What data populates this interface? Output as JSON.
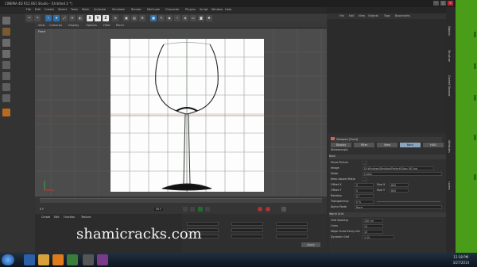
{
  "window": {
    "title": "CINEMA 4D R12.061 Studio - [Untitled 2 *]"
  },
  "menubar": [
    "File",
    "Edit",
    "Create",
    "Select",
    "Tools",
    "Mesh",
    "Animate",
    "Simulate",
    "Render",
    "MoGraph",
    "Character",
    "Plugins",
    "Script",
    "Window",
    "Help"
  ],
  "layout": {
    "label": "Layout:",
    "value": "Startup"
  },
  "toolbar": {
    "x": "X",
    "y": "Y",
    "z": "Z"
  },
  "viewport": {
    "menu": [
      "View",
      "Cameras",
      "Display",
      "Options",
      "Filter",
      "Panel"
    ],
    "label": "Front"
  },
  "timeline": {
    "start": "0 F",
    "end": "90 F",
    "current": "0 F"
  },
  "material_manager": {
    "menu": [
      "Create",
      "Edit",
      "Function",
      "Texture"
    ]
  },
  "coords": {
    "apply": "Apply"
  },
  "object_manager": {
    "menu": [
      "File",
      "Edit",
      "View",
      "Objects",
      "Tags",
      "Bookmarks"
    ]
  },
  "attributes": {
    "menu": [
      "Mode",
      "Edit",
      "User Data"
    ],
    "title": "Viewport [Front]",
    "tabs": [
      "Display",
      "Filter",
      "View",
      "Back",
      "HUD"
    ],
    "subtab": "Stereoscopic",
    "section_back": "Back",
    "rows": [
      {
        "label": "Show Picture",
        "value": "✓"
      },
      {
        "label": "Image",
        "value": "D:\\Windows\\Desktop\\Project\\Glass_BG.jpg"
      },
      {
        "label": "Mode",
        "value": "Linear"
      },
      {
        "label": "Keep Aspect Ratio",
        "value": "✓"
      },
      {
        "label": "Offset X",
        "value": "0",
        "size_label": "Size X",
        "size_value": "800"
      },
      {
        "label": "Offset Y",
        "value": "0",
        "size_label": "Size Y",
        "size_value": "800"
      },
      {
        "label": "Rotation",
        "value": "0 °"
      },
      {
        "label": "Transparency",
        "value": "0 %"
      },
      {
        "label": "Alpha Mode",
        "value": "None"
      }
    ],
    "section_grid": "World Grid",
    "grid_rows": [
      {
        "label": "Grid Spacing",
        "value": "100 cm"
      },
      {
        "label": "Lines",
        "value": "10"
      },
      {
        "label": "Major Lines Every nth",
        "value": "10"
      },
      {
        "label": "Dynamic Grid",
        "value": "1:10"
      }
    ]
  },
  "status": "Move: Click and drag to move elements. Hold down SHIFT to quantize movement / add to the selection in point mode, CTRL to remove.",
  "watermark": "shamicracks.com",
  "clock": {
    "time": "12:18 PM",
    "date": "3/27/2014"
  },
  "side_tabs": [
    "Objects",
    "Structure",
    "Content Browser",
    "Attributes",
    "Layers"
  ],
  "icons": [
    "undo-icon",
    "redo-icon",
    "select-icon",
    "move-icon",
    "scale-icon",
    "rotate-icon",
    "render-icon",
    "folder-icon",
    "cube-icon"
  ]
}
